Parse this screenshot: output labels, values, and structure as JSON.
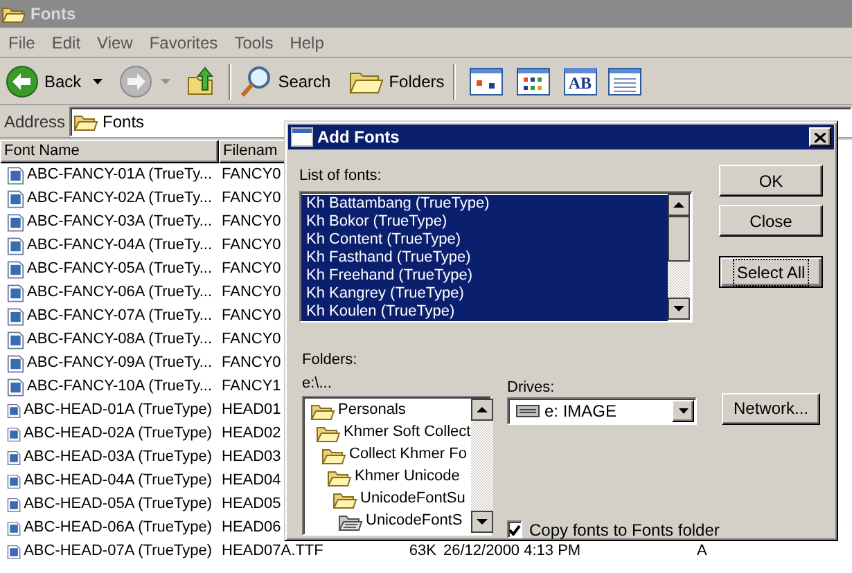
{
  "window": {
    "title": "Fonts"
  },
  "menu": [
    "File",
    "Edit",
    "View",
    "Favorites",
    "Tools",
    "Help"
  ],
  "toolbar": [
    {
      "kind": "back",
      "label": "Back"
    },
    {
      "kind": "forward"
    },
    {
      "kind": "up"
    },
    {
      "kind": "search",
      "label": "Search"
    },
    {
      "kind": "folders",
      "label": "Folders"
    },
    {
      "kind": "view-tiles"
    },
    {
      "kind": "view-icons"
    },
    {
      "kind": "view-text",
      "label": "AB"
    },
    {
      "kind": "view-details"
    }
  ],
  "address": {
    "label": "Address",
    "value": "Fonts"
  },
  "font_list": {
    "columns": [
      "Font Name",
      "Filenam"
    ],
    "rows": [
      {
        "name": "ABC-FANCY-01A (TrueTy...",
        "filename": "FANCY0"
      },
      {
        "name": "ABC-FANCY-02A (TrueTy...",
        "filename": "FANCY0"
      },
      {
        "name": "ABC-FANCY-03A (TrueTy...",
        "filename": "FANCY0"
      },
      {
        "name": "ABC-FANCY-04A (TrueTy...",
        "filename": "FANCY0"
      },
      {
        "name": "ABC-FANCY-05A (TrueTy...",
        "filename": "FANCY0"
      },
      {
        "name": "ABC-FANCY-06A (TrueTy...",
        "filename": "FANCY0"
      },
      {
        "name": "ABC-FANCY-07A (TrueTy...",
        "filename": "FANCY0"
      },
      {
        "name": "ABC-FANCY-08A (TrueTy...",
        "filename": "FANCY0"
      },
      {
        "name": "ABC-FANCY-09A (TrueTy...",
        "filename": "FANCY0"
      },
      {
        "name": "ABC-FANCY-10A (TrueTy...",
        "filename": "FANCY1"
      },
      {
        "name": "ABC-HEAD-01A (TrueType)",
        "filename": "HEAD01"
      },
      {
        "name": "ABC-HEAD-02A (TrueType)",
        "filename": "HEAD02"
      },
      {
        "name": "ABC-HEAD-03A (TrueType)",
        "filename": "HEAD03"
      },
      {
        "name": "ABC-HEAD-04A (TrueType)",
        "filename": "HEAD04"
      },
      {
        "name": "ABC-HEAD-05A (TrueType)",
        "filename": "HEAD05"
      },
      {
        "name": "ABC-HEAD-06A (TrueType)",
        "filename": "HEAD06"
      },
      {
        "name": "ABC-HEAD-07A (TrueType)",
        "filename": "HEAD07A.TTF",
        "size": "63K",
        "modified": "26/12/2000 4:13 PM",
        "attributes": "A"
      }
    ]
  },
  "dialog": {
    "title": "Add Fonts",
    "list_label": "List of fonts:",
    "fonts": [
      {
        "label": "Kh Battambang (TrueType)",
        "selected": true
      },
      {
        "label": "Kh Bokor (TrueType)",
        "selected": true
      },
      {
        "label": "Kh Content (TrueType)",
        "selected": true
      },
      {
        "label": "Kh Fasthand (TrueType)",
        "selected": true
      },
      {
        "label": "Kh Freehand (TrueType)",
        "selected": true
      },
      {
        "label": "Kh Kangrey (TrueType)",
        "selected": true
      },
      {
        "label": "Kh Koulen (TrueType)",
        "selected": true
      }
    ],
    "buttons": [
      {
        "label": "OK",
        "focused": false
      },
      {
        "label": "Close",
        "focused": false
      },
      {
        "label": "Select All",
        "focused": true
      }
    ],
    "folders_label": "Folders:",
    "path": "e:\\...",
    "folders": [
      {
        "label": "Personals",
        "selected": false,
        "children": [
          {
            "label": "Khmer Soft Collect",
            "selected": false,
            "children": [
              {
                "label": "Collect Khmer Fo",
                "selected": false,
                "children": [
                  {
                    "label": "Khmer Unicode",
                    "selected": false,
                    "children": [
                      {
                        "label": "UnicodeFontSu",
                        "selected": false,
                        "children": [
                          {
                            "label": "UnicodeFontS",
                            "selected": true
                          }
                        ]
                      }
                    ]
                  }
                ]
              }
            ]
          }
        ]
      }
    ],
    "drives_label": "Drives:",
    "drive": "e: IMAGE",
    "network_button": "Network...",
    "copy_checkbox": {
      "label": "Copy fonts to Fonts folder",
      "checked": true
    }
  }
}
